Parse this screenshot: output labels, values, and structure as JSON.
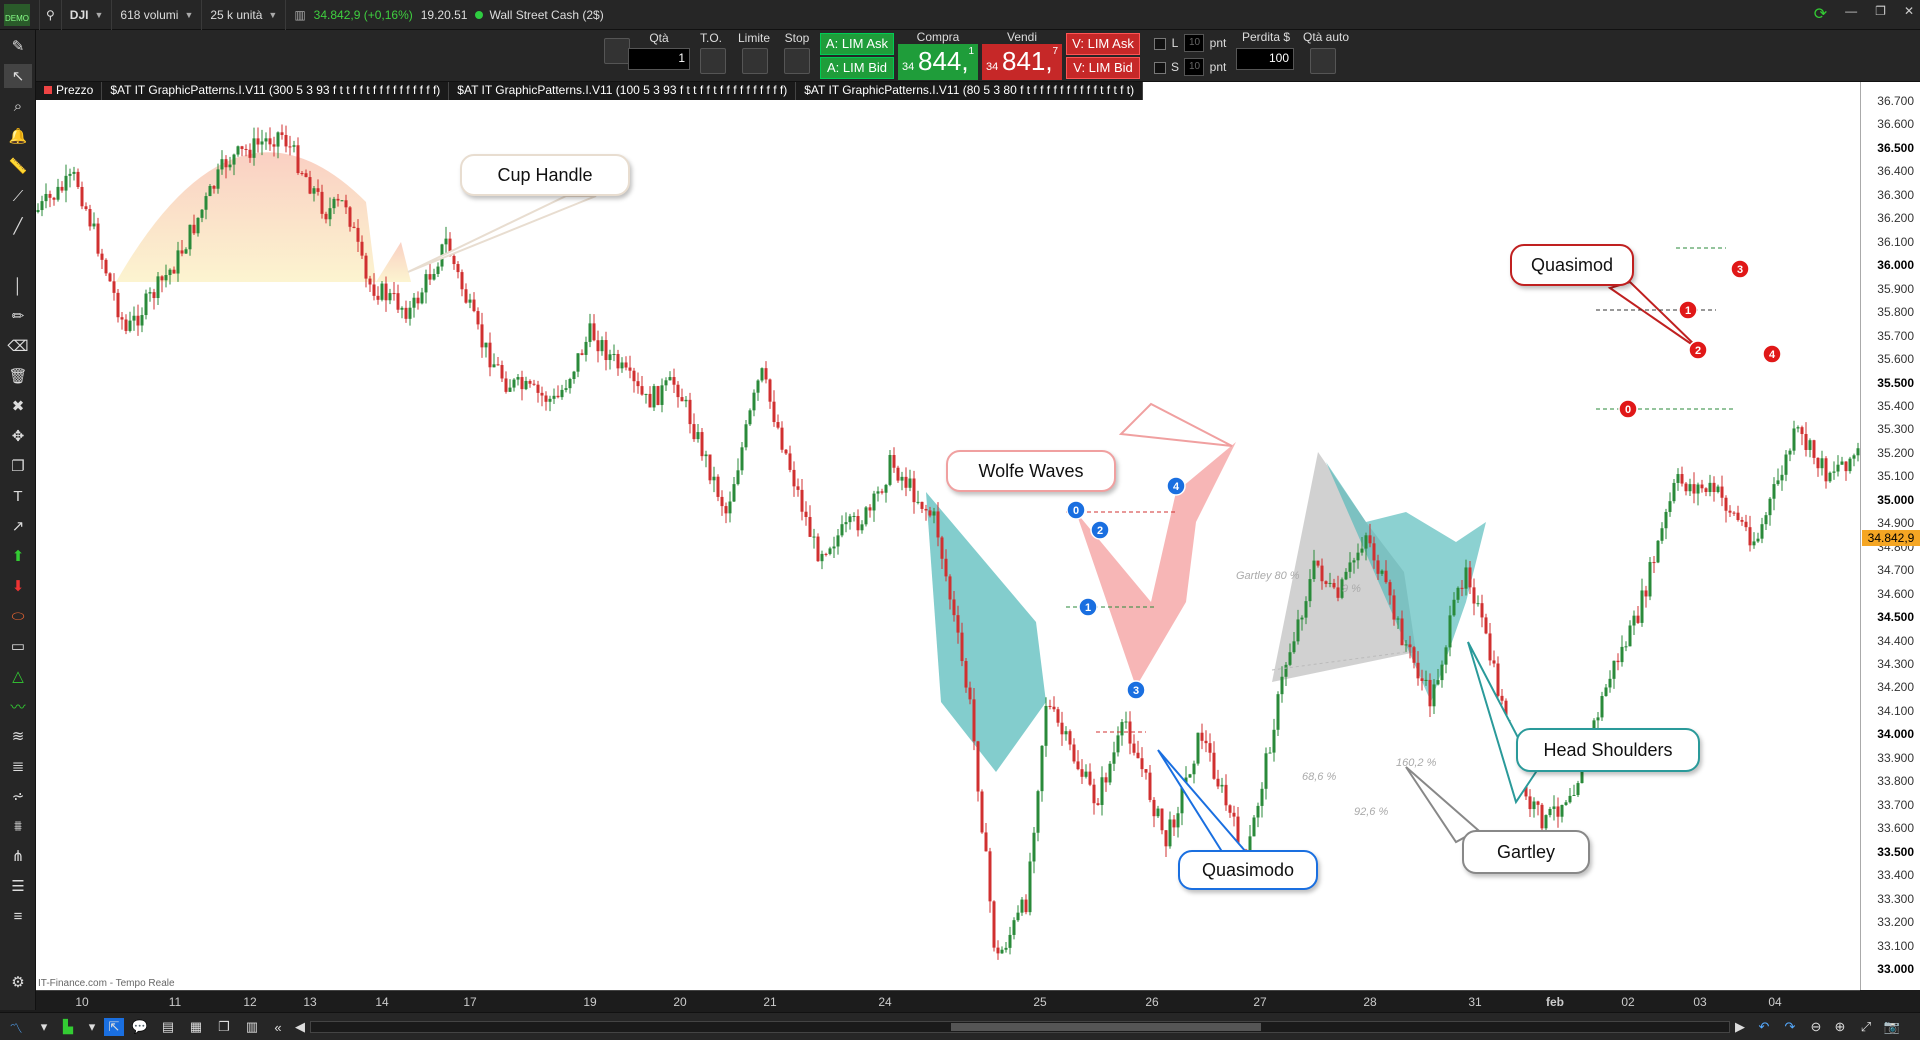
{
  "toolbar": {
    "symbol": "DJI",
    "volume": "618 volumi",
    "units": "25 k unità",
    "price_change": "34.842,9 (+0,16%)",
    "time": "19.20.51",
    "feed": "Wall Street Cash (2$)",
    "badge": "DEMO"
  },
  "trade": {
    "qty_label": "Qtà",
    "qty_value": "1",
    "to_label": "T.O.",
    "limit_label": "Limite",
    "stop_label": "Stop",
    "lim_ask_buy": "A: LIM Ask",
    "lim_bid_buy": "A: LIM Bid",
    "buy_label": "Compra",
    "buy_big": "844,",
    "buy_small": "34",
    "buy_sup": "1",
    "sell_label": "Vendi",
    "sell_big": "841,",
    "sell_small": "34",
    "sell_sup": "7",
    "lim_ask_sell": "V: LIM Ask",
    "lim_bid_sell": "V: LIM Bid",
    "l_label": "L",
    "s_label": "S",
    "pts_value": "10",
    "pnt": "pnt",
    "loss_label": "Perdita $",
    "loss_value": "100",
    "auto_qty": "Qtà auto"
  },
  "legend": [
    "Prezzo",
    "$AT IT GraphicPatterns.I.V11 (300 5 3 93 f t t f f t f f f f f f f f f f)",
    "$AT IT GraphicPatterns.I.V11 (100 5 3 93 f t t f f t f f f f f f f f f f)",
    "$AT IT GraphicPatterns.I.V11 (80 5 3 80 f t f f f f f f f f f f t f t f t)"
  ],
  "watermark": "IT-Finance.com - Tempo Reale",
  "price_axis": [
    {
      "v": "36.700",
      "b": false
    },
    {
      "v": "36.600",
      "b": false
    },
    {
      "v": "36.500",
      "b": true
    },
    {
      "v": "36.400",
      "b": false
    },
    {
      "v": "36.300",
      "b": false
    },
    {
      "v": "36.200",
      "b": false
    },
    {
      "v": "36.100",
      "b": false
    },
    {
      "v": "36.000",
      "b": true
    },
    {
      "v": "35.900",
      "b": false
    },
    {
      "v": "35.800",
      "b": false
    },
    {
      "v": "35.700",
      "b": false
    },
    {
      "v": "35.600",
      "b": false
    },
    {
      "v": "35.500",
      "b": true
    },
    {
      "v": "35.400",
      "b": false
    },
    {
      "v": "35.300",
      "b": false
    },
    {
      "v": "35.200",
      "b": false
    },
    {
      "v": "35.100",
      "b": false
    },
    {
      "v": "35.000",
      "b": true
    },
    {
      "v": "34.900",
      "b": false
    },
    {
      "v": "34.800",
      "b": false
    },
    {
      "v": "34.700",
      "b": false
    },
    {
      "v": "34.600",
      "b": false
    },
    {
      "v": "34.500",
      "b": true
    },
    {
      "v": "34.400",
      "b": false
    },
    {
      "v": "34.300",
      "b": false
    },
    {
      "v": "34.200",
      "b": false
    },
    {
      "v": "34.100",
      "b": false
    },
    {
      "v": "34.000",
      "b": true
    },
    {
      "v": "33.900",
      "b": false
    },
    {
      "v": "33.800",
      "b": false
    },
    {
      "v": "33.700",
      "b": false
    },
    {
      "v": "33.600",
      "b": false
    },
    {
      "v": "33.500",
      "b": true
    },
    {
      "v": "33.400",
      "b": false
    },
    {
      "v": "33.300",
      "b": false
    },
    {
      "v": "33.200",
      "b": false
    },
    {
      "v": "33.100",
      "b": false
    },
    {
      "v": "33.000",
      "b": true
    }
  ],
  "current_price": "34.842,9",
  "time_axis": [
    "10",
    "11",
    "12",
    "13",
    "14",
    "17",
    "19",
    "20",
    "21",
    "24",
    "25",
    "26",
    "27",
    "28",
    "31",
    "feb",
    "02",
    "03",
    "04"
  ],
  "callouts": {
    "cup": "Cup Handle",
    "wolfe": "Wolfe Waves",
    "quasimodo": "Quasimodo",
    "gartley": "Gartley",
    "headshoulders": "Head Shoulders",
    "quasimod": "Quasimod"
  },
  "annotations": {
    "gartley80": "Gartley 80 %",
    "pct1": "68,6 %",
    "pct2": "92,6 %",
    "pct3": "160,2 %",
    "pct4": "9 %"
  },
  "colors": {
    "up": "#2a8a3a",
    "down": "#d03030",
    "teal": "#4fb8b8",
    "wolfe": "#f07a7a",
    "blue": "#1a6fe0",
    "red": "#e01818"
  }
}
